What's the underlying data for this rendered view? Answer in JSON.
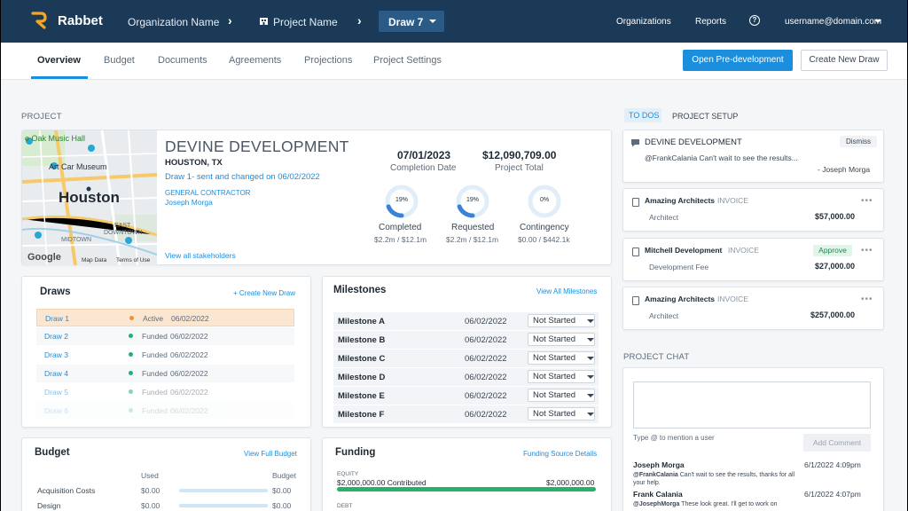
{
  "nav": {
    "brand": "Rabbet",
    "org": "Organization Name",
    "project": "Project Name",
    "draw": "Draw 7",
    "organizations": "Organizations",
    "reports": "Reports",
    "help": "?",
    "user": "username@domain.com"
  },
  "tabs": [
    "Overview",
    "Budget",
    "Documents",
    "Agreements",
    "Projections",
    "Project Settings"
  ],
  "actions": {
    "open_predev": "Open Pre-development",
    "create_draw": "Create New Draw"
  },
  "project": {
    "section": "PROJECT",
    "name": "DEVINE DEVELOPMENT",
    "city": "HOUSTON, TX",
    "draw_status": "Draw 1- sent and changed on 06/02/2022",
    "gc_label": "GENERAL CONTRACTOR",
    "gc_name": "Joseph Morga",
    "view_stakeholders": "View all stakeholders",
    "completion_date": "07/01/2023",
    "completion_label": "Completion Date",
    "total": "$12,090,709.00",
    "total_label": "Project Total",
    "rings": [
      {
        "pct": "19%",
        "label": "Completed",
        "sub": "$2.2m / $12.1m",
        "fraction": 0.19
      },
      {
        "pct": "19%",
        "label": "Requested",
        "sub": "$2.2m / $12.1m",
        "fraction": 0.19
      },
      {
        "pct": "0%",
        "label": "Contingency",
        "sub": "$0.00 / $442.1k",
        "fraction": 0
      }
    ],
    "map": {
      "labels": [
        "e Oak Music Hall",
        "Art Car Museum",
        "Houston",
        "EAST",
        "DOWNTOWN",
        "MIDTOWN",
        "Map Data",
        "Terms of Use",
        "Google"
      ]
    }
  },
  "draws": {
    "title": "Draws",
    "create": "+ Create New Draw",
    "rows": [
      {
        "name": "Draw 1",
        "status": "Active",
        "date": "06/02/2022",
        "color": "#f0913a"
      },
      {
        "name": "Draw 2",
        "status": "Funded",
        "date": "06/02/2022",
        "color": "#1db27a"
      },
      {
        "name": "Draw 3",
        "status": "Funded",
        "date": "06/02/2022",
        "color": "#1db27a"
      },
      {
        "name": "Draw 4",
        "status": "Funded",
        "date": "06/02/2022",
        "color": "#1db27a"
      },
      {
        "name": "Draw 5",
        "status": "Funded",
        "date": "06/02/2022",
        "color": "#1db27a"
      },
      {
        "name": "Draw 6",
        "status": "Funded",
        "date": "06/02/2022",
        "color": "#1db27a"
      }
    ]
  },
  "milestones": {
    "title": "Milestones",
    "view_all": "View All Milestones",
    "rows": [
      {
        "name": "Milestone A",
        "date": "06/02/2022",
        "status": "Not Started"
      },
      {
        "name": "Milestone B",
        "date": "06/02/2022",
        "status": "Not Started"
      },
      {
        "name": "Milestone C",
        "date": "06/02/2022",
        "status": "Not Started"
      },
      {
        "name": "Milestone D",
        "date": "06/02/2022",
        "status": "Not Started"
      },
      {
        "name": "Milestone E",
        "date": "06/02/2022",
        "status": "Not Started"
      },
      {
        "name": "Milestone F",
        "date": "06/02/2022",
        "status": "Not Started"
      }
    ]
  },
  "budget": {
    "title": "Budget",
    "view_full": "View Full Budget",
    "col_used": "Used",
    "col_budget": "Budget",
    "rows": [
      {
        "name": "Acquisition Costs",
        "used": "$0.00",
        "budget": "$0.00"
      },
      {
        "name": "Design",
        "used": "$0.00",
        "budget": "$0.00"
      }
    ]
  },
  "funding": {
    "title": "Funding",
    "details": "Funding Source Details",
    "equity_label": "EQUITY",
    "equity_contrib": "$2,000,000.00 Contributed",
    "equity_total": "$2,000,000.00",
    "equity_fraction": 1.0,
    "debt_label": "DEBT"
  },
  "todos": {
    "tab_todos": "TO DOS",
    "tab_setup": "PROJECT SETUP",
    "message": {
      "title": "DEVINE DEVELOPMENT",
      "dismiss": "Dismiss",
      "text": "@FrankCalania Can't wait to see the results...",
      "author": "- Joseph Morga"
    },
    "invoices": [
      {
        "vendor": "Amazing Architects",
        "type": "INVOICE",
        "badge": "",
        "line": "Architect",
        "amount": "$57,000.00"
      },
      {
        "vendor": "Mitchell Development",
        "type": "INVOICE",
        "badge": "Approve",
        "line": "Development Fee",
        "amount": "$27,000.00"
      },
      {
        "vendor": "Amazing Architects",
        "type": "INVOICE",
        "badge": "",
        "line": "Architect",
        "amount": "$257,000.00"
      }
    ],
    "more": "•••"
  },
  "chat": {
    "section": "PROJECT CHAT",
    "hint": "Type @ to mention a user",
    "add": "Add Comment",
    "messages": [
      {
        "author": "Joseph Morga",
        "time": "6/1/2022 4:09pm",
        "mention": "@FrankCalania",
        "text": " Can't wait to see the results, thanks for all",
        "text2": "your help."
      },
      {
        "author": "Frank Calania",
        "time": "6/1/2022 4:07pm",
        "mention": "@JosephMorga",
        "text": " These look great. I'll get to work on",
        "text2": ""
      }
    ]
  },
  "colors": {
    "navy": "#1b3a57",
    "accent": "#1b8ede",
    "active": "#f0913a",
    "funded": "#1db27a",
    "logo": "#f5a623"
  }
}
